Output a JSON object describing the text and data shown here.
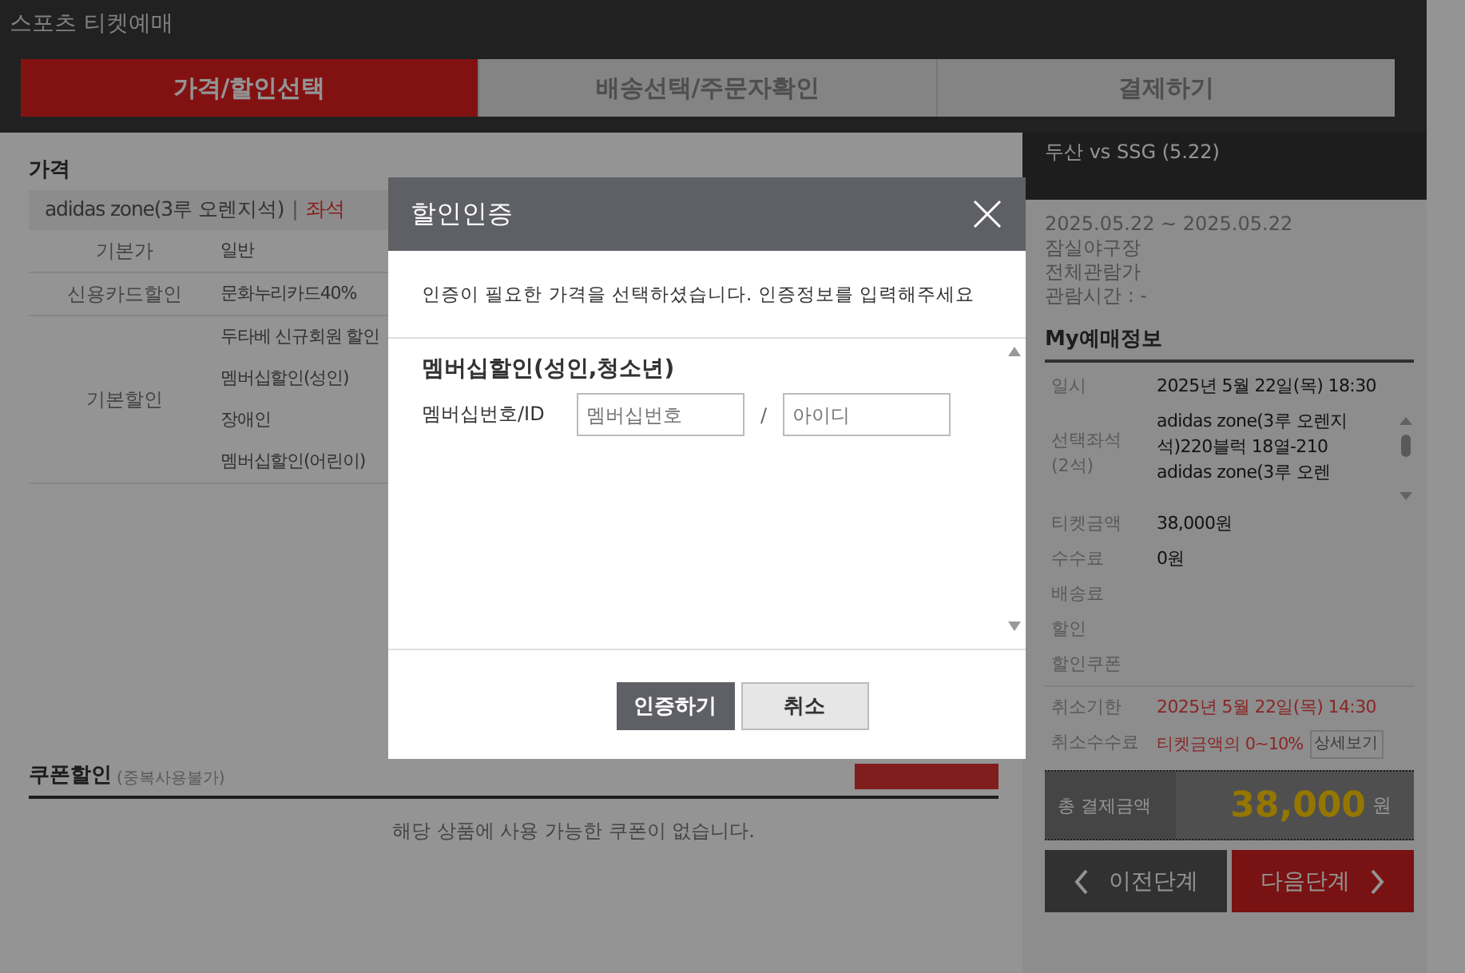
{
  "site_title": "스포츠 티켓예매",
  "steps": [
    {
      "label": "가격/할인선택",
      "selected": true
    },
    {
      "label": "배송선택/주문자확인",
      "selected": false
    },
    {
      "label": "결제하기",
      "selected": false
    }
  ],
  "price_section": {
    "title": "가격",
    "zone": "adidas zone(3루 오렌지석)",
    "zone_sep": "|",
    "zone_note": "좌석",
    "groups": [
      {
        "name": "기본가",
        "options": [
          "일반"
        ]
      },
      {
        "name": "신용카드할인",
        "options": [
          "문화누리카드40%"
        ]
      },
      {
        "name": "기본할인",
        "options": [
          "두타베 신규회원 할인",
          "멤버십할인(성인)",
          "장애인",
          "멤버십할인(어린이)"
        ]
      }
    ]
  },
  "coupon_section": {
    "title": "쿠폰할인",
    "note": "(중복사용불가)",
    "empty_message": "해당 상품에 사용 가능한 쿠폰이 없습니다."
  },
  "event": {
    "title": "두산 vs SSG (5.22)",
    "lines": [
      "2025.05.22 ~ 2025.05.22",
      "잠실야구장",
      "전체관람가",
      "관람시간 : -"
    ]
  },
  "my_booking": {
    "title": "My예매정보",
    "rows": [
      {
        "label": "일시",
        "value": "2025년 5월 22일(목) 18:30",
        "kind": "text"
      },
      {
        "label": "선택좌석\n(2석)",
        "value": "adidas zone(3루 오렌지석)220블럭 18열-210\nadidas zone(3루 오렌",
        "kind": "scroll"
      },
      {
        "label": "티켓금액",
        "value": "38,000원",
        "kind": "text"
      },
      {
        "label": "수수료",
        "value": "0원",
        "kind": "text"
      },
      {
        "label": "배송료",
        "value": "",
        "kind": "text"
      },
      {
        "label": "할인",
        "value": "",
        "kind": "text"
      },
      {
        "label": "할인쿠폰",
        "value": "",
        "kind": "text"
      },
      {
        "label": "취소기한",
        "value": "2025년 5월 22일(목) 14:30",
        "kind": "alert"
      },
      {
        "label": "취소수수료",
        "value": "티켓금액의 0~10%",
        "kind": "link",
        "link": "상세보기"
      }
    ],
    "total_label": "총 결제금액",
    "total": "38,000",
    "total_unit": "원"
  },
  "nav_buttons": {
    "prev": "이전단계",
    "next": "다음단계"
  },
  "dialog": {
    "title": "할인인증",
    "message": "인증이 필요한 가격을 선택하셨습니다. 인증정보를 입력해주세요",
    "section_title": "멤버십할인(성인,청소년)",
    "field_label": "멤버십번호/ID",
    "fields": [
      {
        "placeholder": "멤버십번호"
      },
      {
        "placeholder": "아이디"
      }
    ],
    "separator": "/",
    "buttons": [
      {
        "label": "인증하기",
        "kind": "primary"
      },
      {
        "label": "취소",
        "kind": "secondary"
      }
    ]
  }
}
